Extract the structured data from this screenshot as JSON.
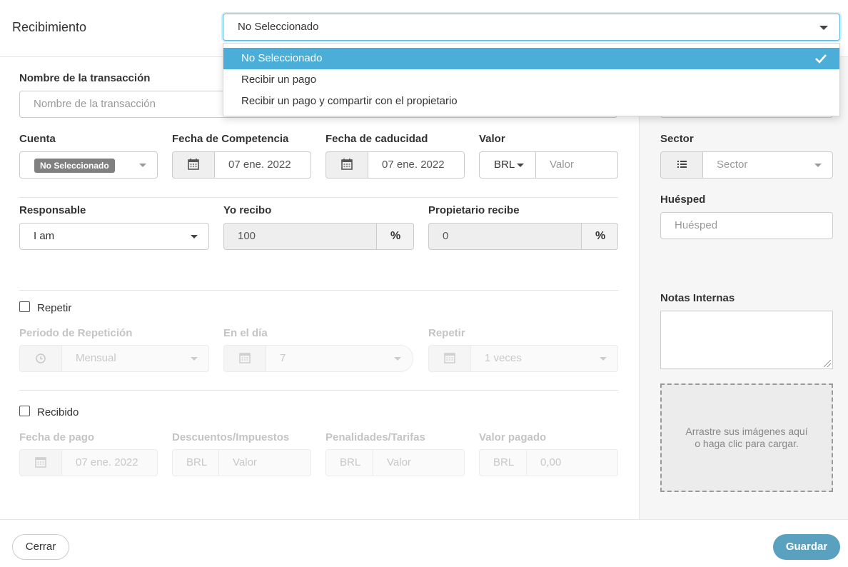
{
  "header": {
    "title": "Recibimiento",
    "type_select_value": "No Seleccionado",
    "type_options": [
      {
        "label": "No Seleccionado",
        "selected": true
      },
      {
        "label": "Recibir un pago",
        "selected": false
      },
      {
        "label": "Recibir un pago y compartir con el propietario",
        "selected": false
      }
    ]
  },
  "form": {
    "transaction_name": {
      "label": "Nombre de la transacción",
      "placeholder": "Nombre de la transacción"
    },
    "account": {
      "label": "Cuenta",
      "badge": "No Seleccionado"
    },
    "competence_date": {
      "label": "Fecha de Competencia",
      "value": "07 ene. 2022"
    },
    "due_date": {
      "label": "Fecha de caducidad",
      "value": "07 ene. 2022"
    },
    "amount": {
      "label": "Valor",
      "currency": "BRL",
      "placeholder": "Valor"
    },
    "responsible": {
      "label": "Responsable",
      "value": "I am"
    },
    "i_receive": {
      "label": "Yo recibo",
      "value": "100",
      "unit": "%"
    },
    "owner_receives": {
      "label": "Propietario recibe",
      "value": "0",
      "unit": "%"
    },
    "repeat": {
      "checkbox_label": "Repetir",
      "checked": false,
      "period_label": "Periodo de Repetición",
      "period_value": "Mensual",
      "day_label": "En el día",
      "day_value": "7",
      "times_label": "Repetir",
      "times_value": "1 veces"
    },
    "received": {
      "checkbox_label": "Recibido",
      "checked": false,
      "payment_date_label": "Fecha de pago",
      "payment_date_value": "07 ene. 2022",
      "discounts_label": "Descuentos/Impuestos",
      "discounts_currency": "BRL",
      "discounts_placeholder": "Valor",
      "penalties_label": "Penalidades/Tarifas",
      "penalties_currency": "BRL",
      "penalties_placeholder": "Valor",
      "paid_label": "Valor pagado",
      "paid_currency": "BRL",
      "paid_value": "0,00"
    }
  },
  "sidebar": {
    "sector_label": "Sector",
    "sector_placeholder": "Sector",
    "guest_label": "Huésped",
    "guest_placeholder": "Huésped",
    "notes_label": "Notas Internas",
    "dropzone_text": "Arrastre sus imágenes aquí o haga clic para cargar."
  },
  "footer": {
    "close_label": "Cerrar",
    "save_label": "Guardar"
  },
  "colors": {
    "accent": "#4aaed8",
    "save_button": "#5aa0bf",
    "badge": "#808080"
  }
}
